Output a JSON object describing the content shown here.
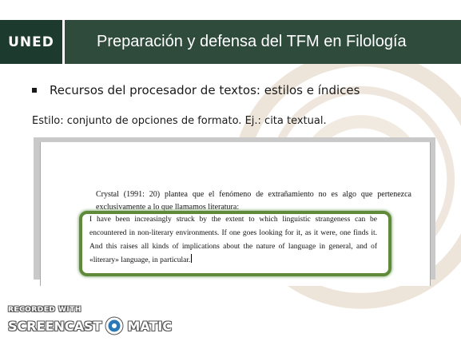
{
  "header": {
    "logo_text": "UNED",
    "title": "Preparación y defensa del TFM en Filología"
  },
  "bullet": {
    "text": "Recursos del procesador de textos: estilos e índices"
  },
  "subtitle": "Estilo: conjunto de opciones de formato. Ej.: cita textual.",
  "document": {
    "intro": "Crystal (1991: 20) plantea que el fenómeno de extrañamiento no es algo que pertenezca exclusivamente a lo que llamamos literatura:",
    "quote": "I have been increasingly struck by the extent to which linguistic strangeness can be encountered in non-literary environments. If one goes looking for it, as it were, one finds it. And this raises all kinds of implications about the nature of language in general, and of «literary» language, in particular."
  },
  "recorder": {
    "line1": "RECORDED WITH",
    "brand_left": "SCREENCAST",
    "brand_right": "MATIC"
  },
  "colors": {
    "header_dark": "#1d3a2f",
    "header_title_bg": "#2f4b3c",
    "quote_border": "#5e8a3a",
    "watermark": "#e3d6c6"
  },
  "icons": {
    "bullet": "square-bullet",
    "recorder_logo": "screencast-o-matic-icon"
  }
}
